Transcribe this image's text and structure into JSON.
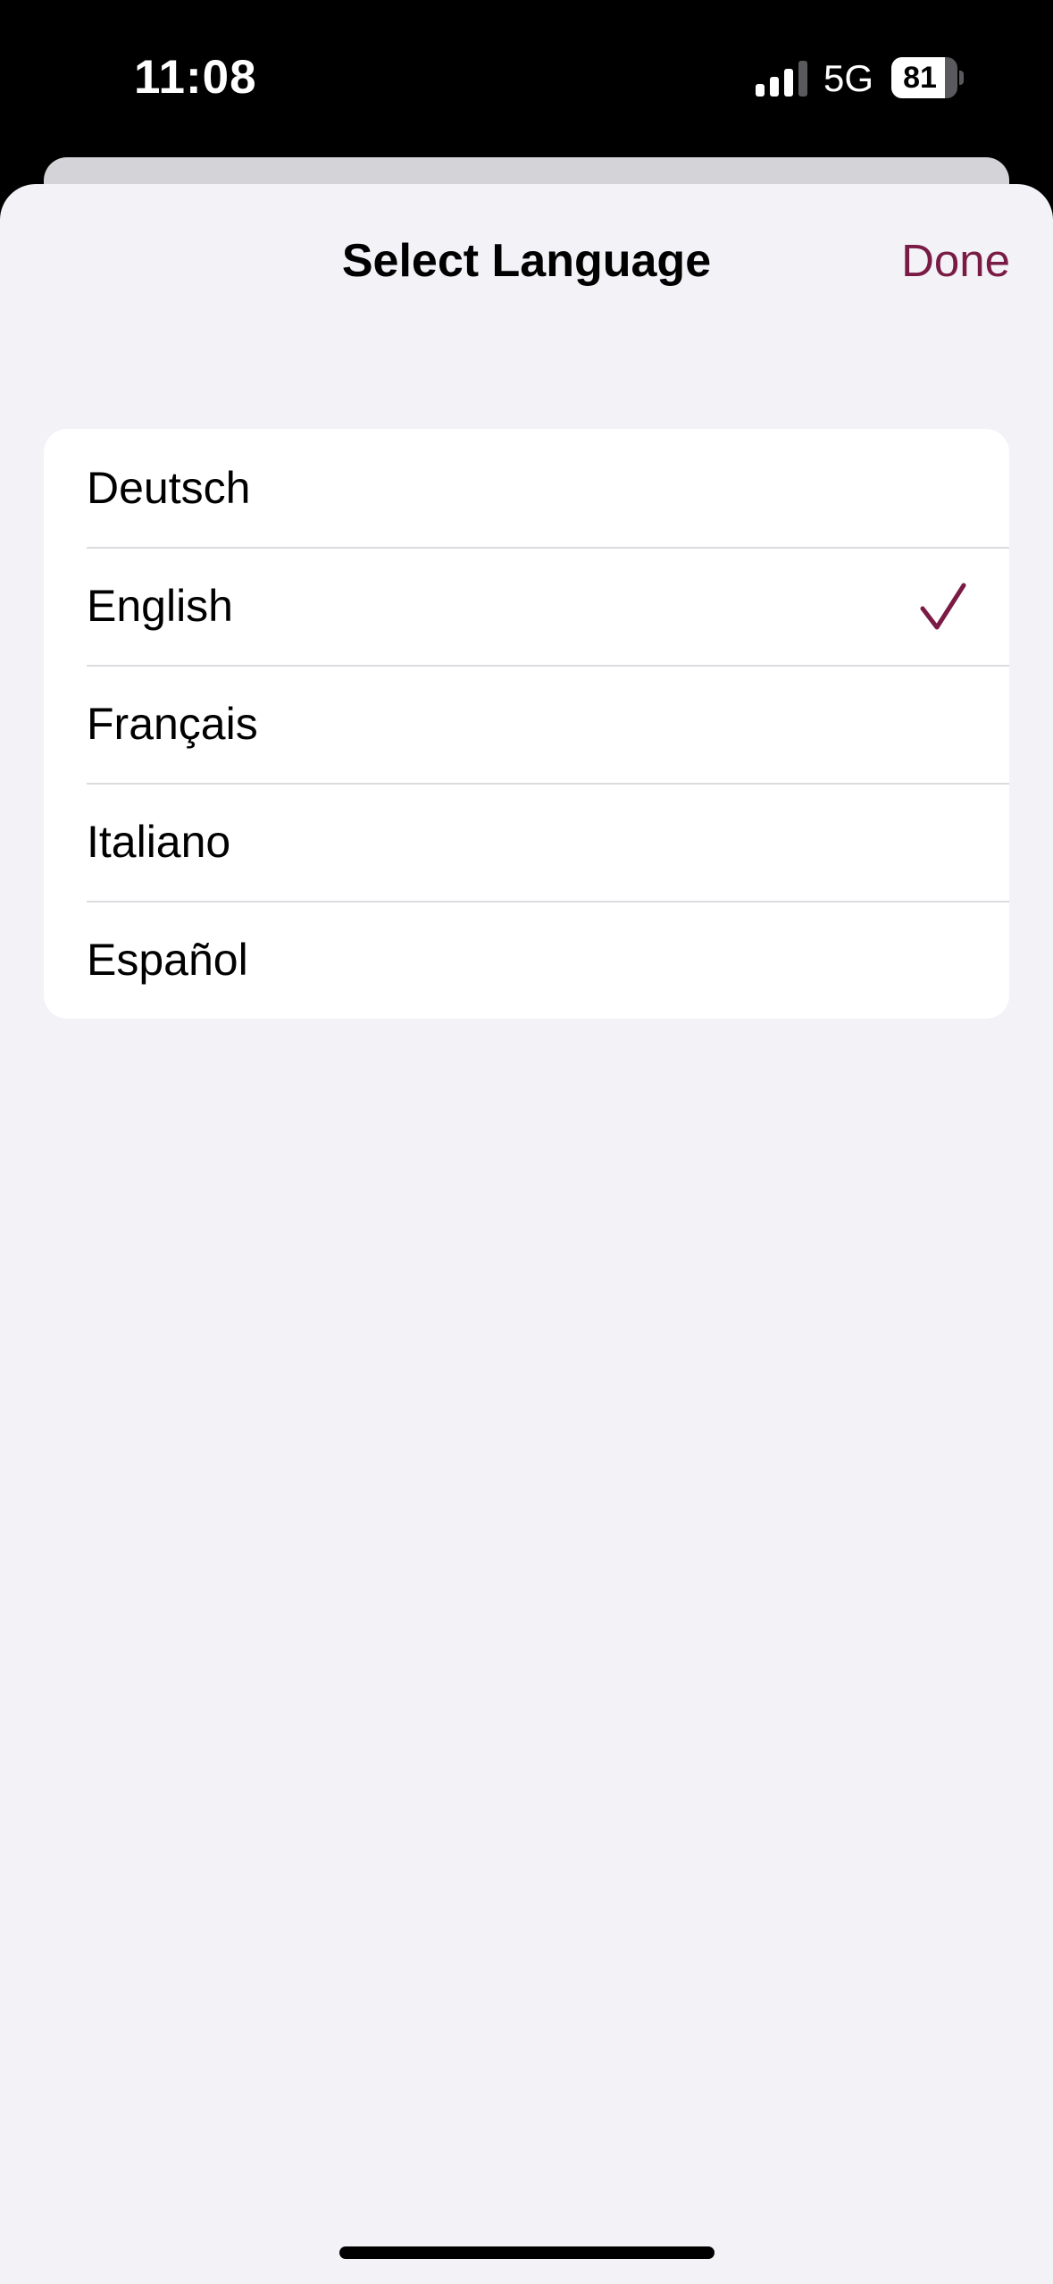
{
  "status_bar": {
    "time": "11:08",
    "network": "5G",
    "battery_level": "81",
    "battery_fraction": 0.81,
    "signal_bars_active": 3,
    "signal_bars_total": 4
  },
  "sheet": {
    "title": "Select Language",
    "done_label": "Done"
  },
  "languages": [
    {
      "label": "Deutsch",
      "selected": false
    },
    {
      "label": "English",
      "selected": true
    },
    {
      "label": "Français",
      "selected": false
    },
    {
      "label": "Italiano",
      "selected": false
    },
    {
      "label": "Español",
      "selected": false
    }
  ],
  "colors": {
    "accent": "#7a1b45",
    "sheet_background": "#f2f2f7",
    "list_background": "#ffffff",
    "separator": "#dcdce0"
  },
  "icons": {
    "selected_marker": "checkmark-icon",
    "signal": "cellular-signal-icon",
    "battery": "battery-icon"
  }
}
